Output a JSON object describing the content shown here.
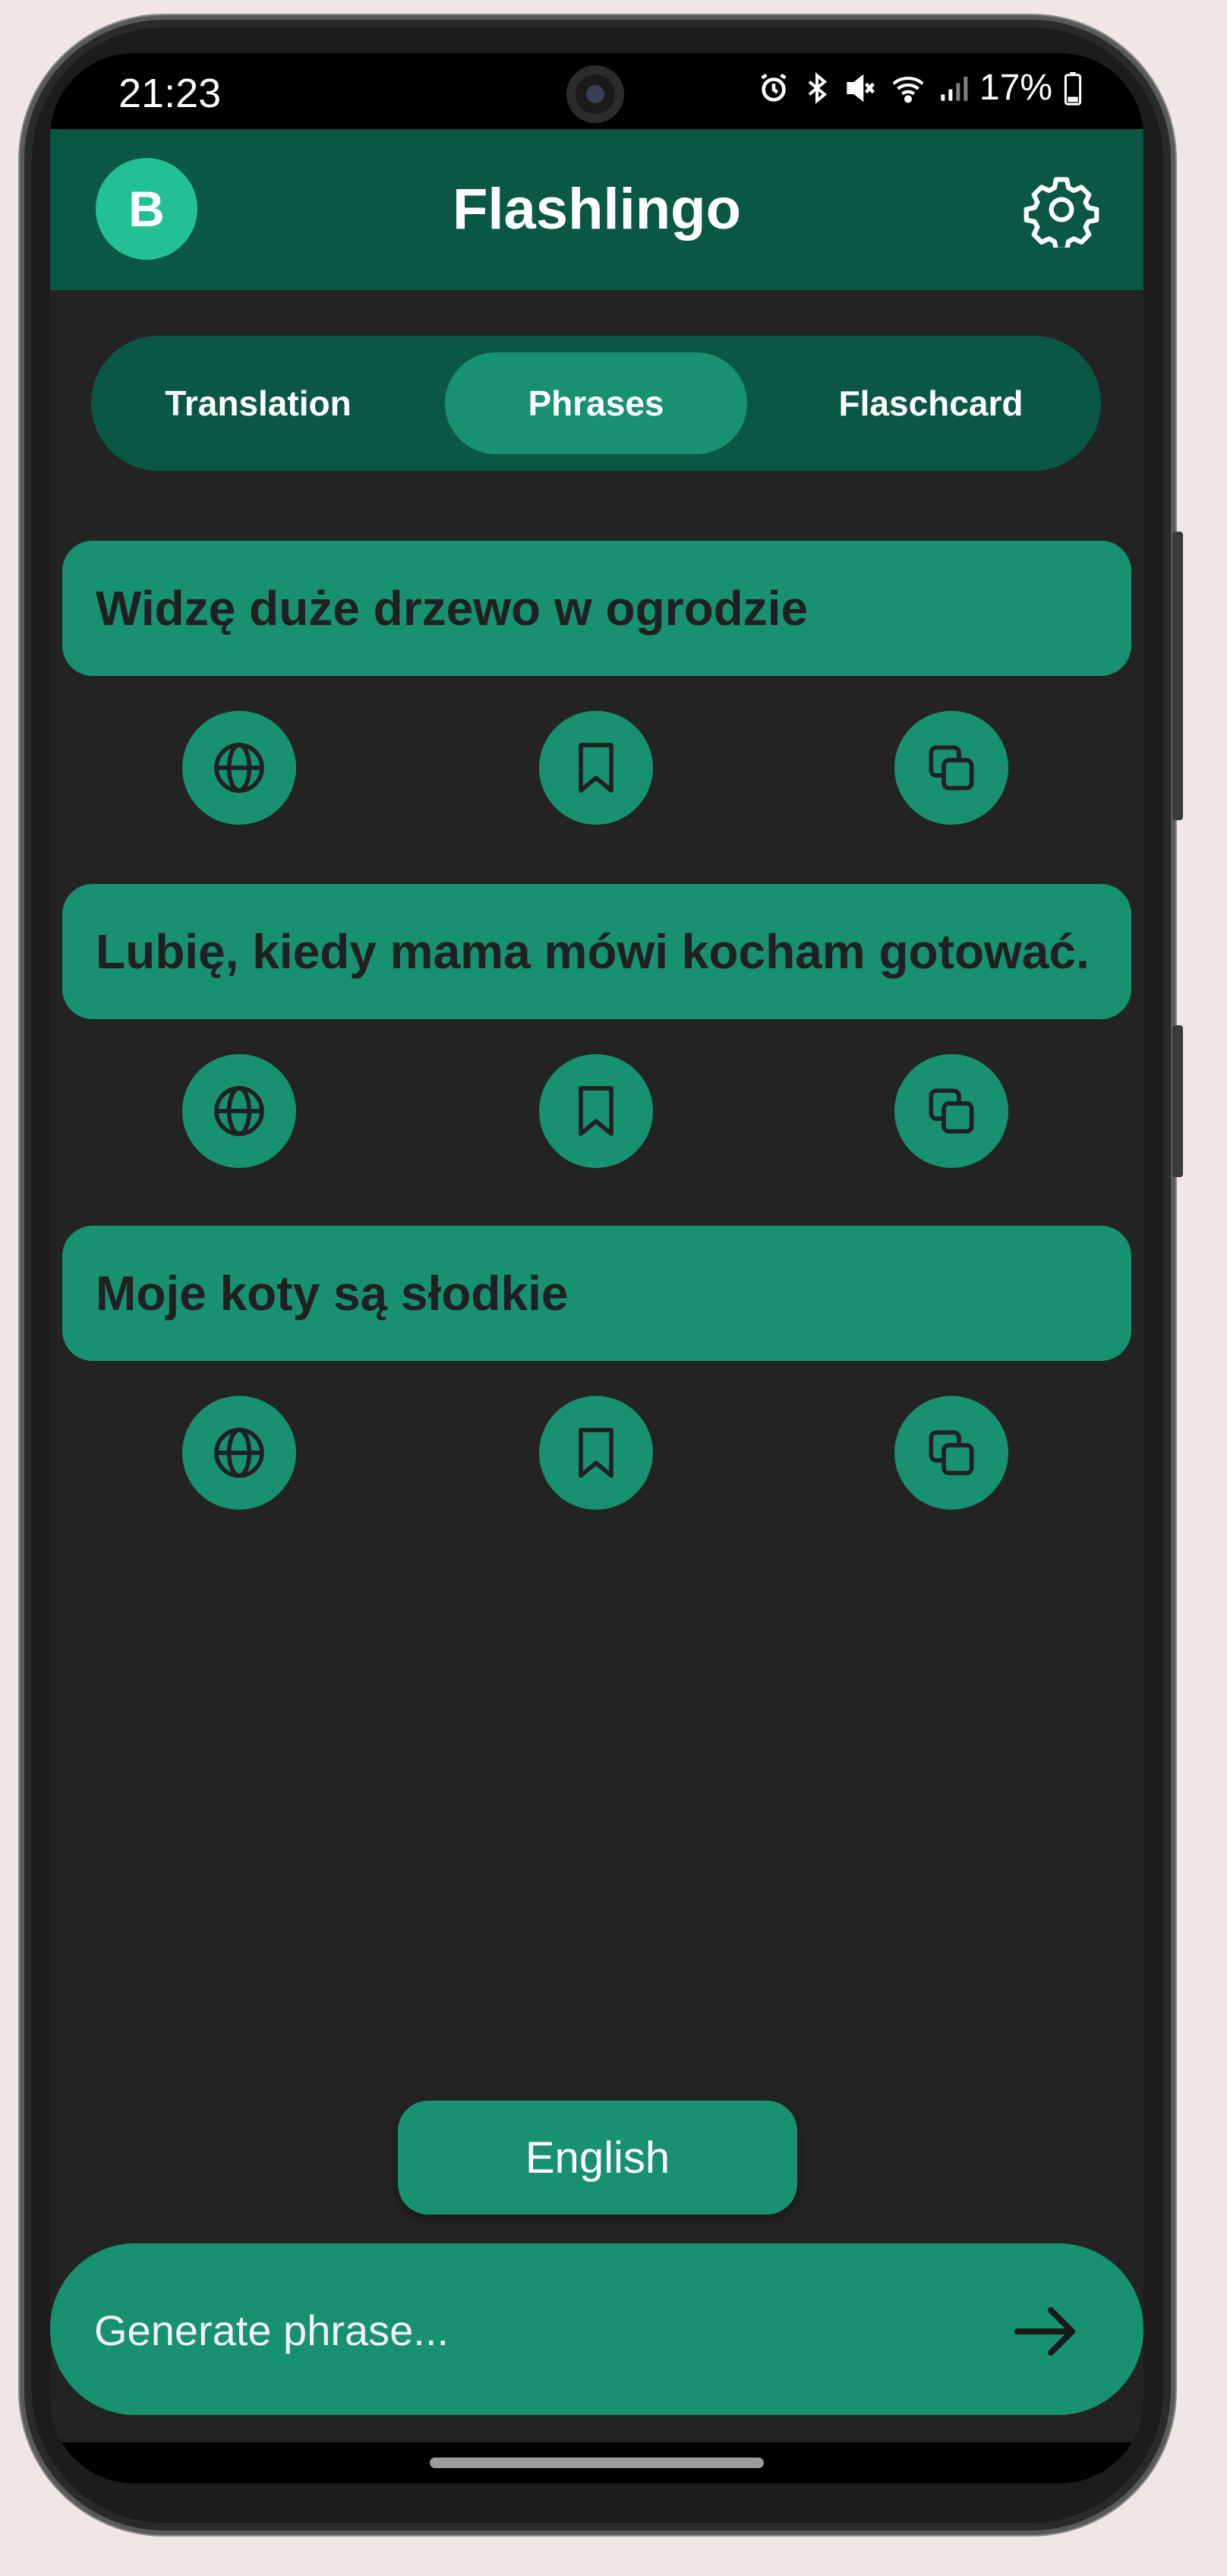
{
  "status_bar": {
    "time": "21:23",
    "battery": "17%",
    "icons": [
      "alarm-icon",
      "bluetooth-icon",
      "mute-icon",
      "wifi-icon",
      "signal-icon",
      "battery-icon"
    ]
  },
  "header": {
    "avatar_letter": "B",
    "title": "Flashlingo",
    "settings_icon": "gear-icon"
  },
  "tabs": [
    {
      "label": "Translation",
      "active": false
    },
    {
      "label": "Phrases",
      "active": true
    },
    {
      "label": "Flaschcard",
      "active": false
    }
  ],
  "phrases": [
    {
      "text": "Widzę duże drzewo w ogrodzie",
      "actions": [
        "globe-icon",
        "bookmark-icon",
        "copy-icon"
      ]
    },
    {
      "text": "Lubię, kiedy mama mówi kocham gotować.",
      "actions": [
        "globe-icon",
        "bookmark-icon",
        "copy-icon"
      ]
    },
    {
      "text": "Moje koty są słodkie",
      "actions": [
        "globe-icon",
        "bookmark-icon",
        "copy-icon"
      ]
    }
  ],
  "language_button": "English",
  "input": {
    "placeholder": "Generate phrase...",
    "value": "",
    "send_icon": "arrow-right-icon"
  },
  "colors": {
    "background": "#232323",
    "header": "#0a5843",
    "accent": "#17916f",
    "avatar": "#22c193",
    "card_text": "#202020"
  }
}
